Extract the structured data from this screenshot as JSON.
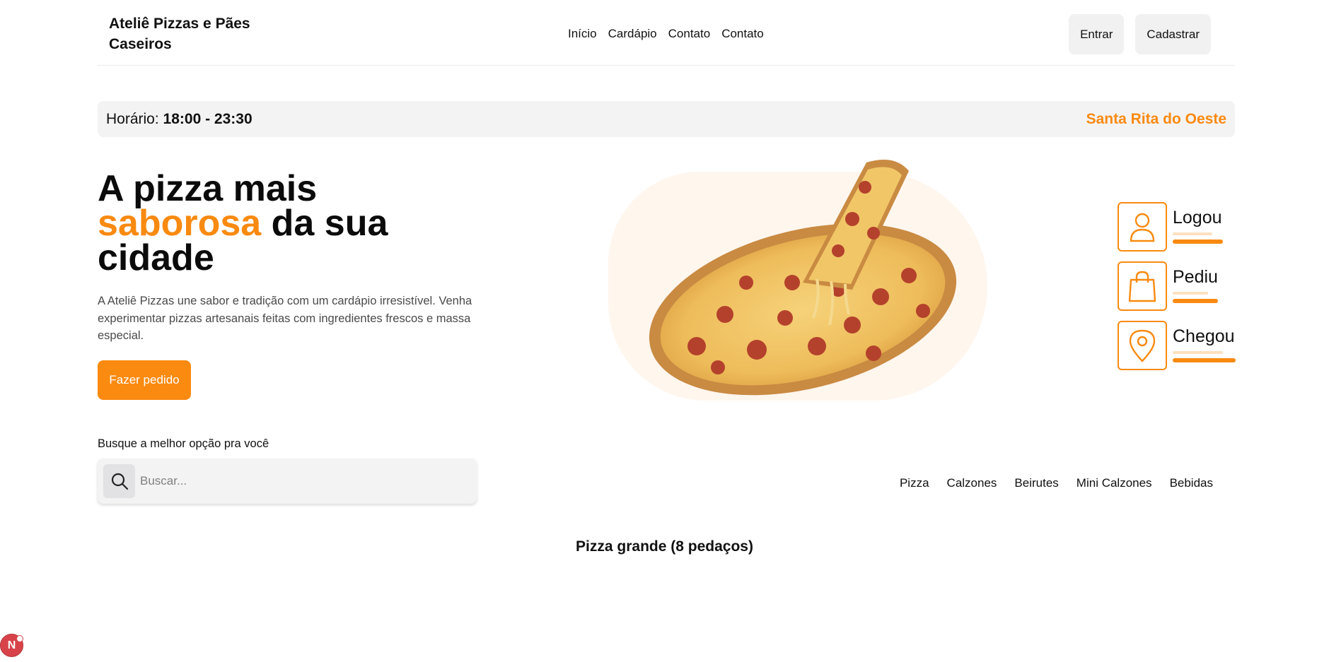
{
  "header": {
    "brand": "Ateliê Pizzas e Pães Caseiros",
    "nav": [
      "Início",
      "Cardápio",
      "Contato",
      "Contato"
    ],
    "login_label": "Entrar",
    "signup_label": "Cadastrar"
  },
  "hours": {
    "label": "Horário:",
    "value": "18:00 - 23:30",
    "city": "Santa Rita do Oeste"
  },
  "hero": {
    "title_part1": "A pizza mais",
    "title_accent": "saborosa",
    "title_part2": " da sua",
    "title_part3": "cidade",
    "description": "A Ateliê Pizzas une sabor e tradição com um cardápio irresistível. Venha experimentar pizzas artesanais feitas com ingredientes frescos e massa especial.",
    "cta_label": "Fazer pedido"
  },
  "steps": [
    {
      "label": "Logou",
      "icon": "user-icon"
    },
    {
      "label": "Pediu",
      "icon": "shopping-bag-icon"
    },
    {
      "label": "Chegou",
      "icon": "map-pin-icon"
    }
  ],
  "search": {
    "label": "Busque a melhor opção pra você",
    "placeholder": "Buscar...",
    "value": ""
  },
  "categories": [
    "Pizza",
    "Calzones",
    "Beirutes",
    "Mini Calzones",
    "Bebidas"
  ],
  "section_title": "Pizza grande (8 pedaços)",
  "dev_badge": "N",
  "colors": {
    "accent": "#f98a10",
    "accent_light": "#fde0c0",
    "surface": "#f3f3f4",
    "pizza_bg": "#fff6ee"
  }
}
